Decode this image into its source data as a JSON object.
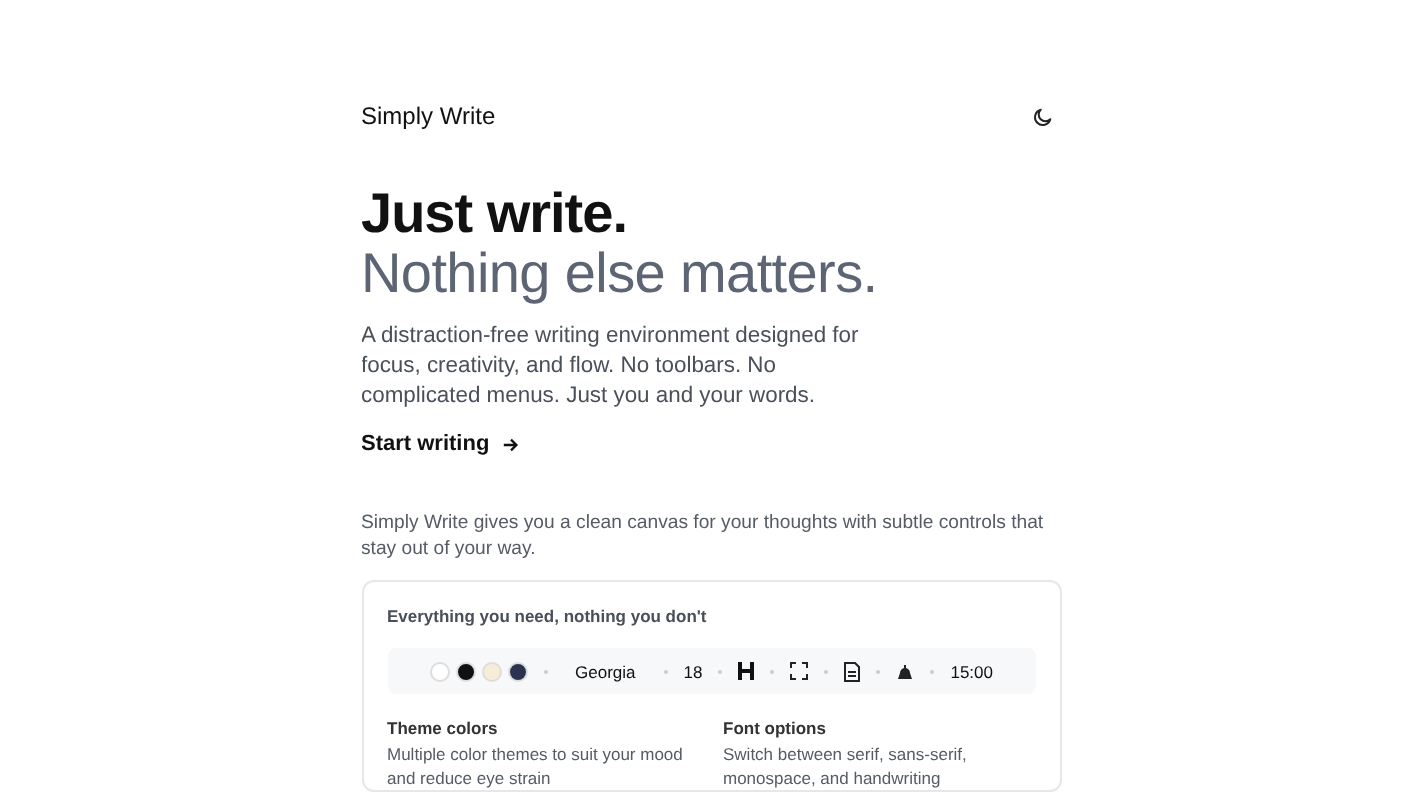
{
  "header": {
    "brand": "Simply Write"
  },
  "hero": {
    "title": "Just write.",
    "subtitle": "Nothing else matters.",
    "lead": "A distraction-free writing environment designed for focus, creativity, and flow. No toolbars. No complicated menus. Just you and your words.",
    "cta": "Start writing"
  },
  "intro": "Simply Write gives you a clean canvas for your thoughts with subtle controls that stay out of your way.",
  "card": {
    "title": "Everything you need, nothing you don't",
    "swatches": [
      {
        "color": "#ffffff"
      },
      {
        "color": "#111111"
      },
      {
        "color": "#f7ecd8"
      },
      {
        "color": "#2c3350"
      }
    ],
    "font": "Georgia",
    "size": "18",
    "timer": "15:00",
    "features": [
      {
        "title": "Theme colors",
        "text": "Multiple color themes to suit your mood and reduce eye strain"
      },
      {
        "title": "Font options",
        "text": "Switch between serif, sans-serif, monospace, and handwriting"
      }
    ]
  }
}
